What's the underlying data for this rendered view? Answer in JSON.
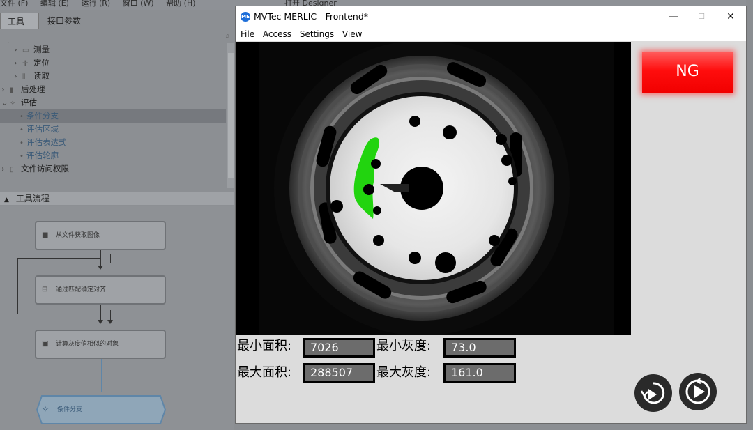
{
  "designer": {
    "menu": [
      "文件 (F)",
      "编辑 (E)",
      "运行 (R)",
      "窗口 (W)",
      "帮助 (H)",
      "打开 Designer"
    ],
    "tabs": [
      "工具库",
      "接口参数"
    ],
    "tree": [
      {
        "label": "测量",
        "level": 1
      },
      {
        "label": "定位",
        "level": 1
      },
      {
        "label": "读取",
        "level": 1
      },
      {
        "label": "后处理",
        "level": 0
      },
      {
        "label": "评估",
        "level": 0
      },
      {
        "label": "条件分支",
        "level": 2
      },
      {
        "label": "评估区域",
        "level": 2
      },
      {
        "label": "评估表达式",
        "level": 2
      },
      {
        "label": "评估轮廓",
        "level": 2
      },
      {
        "label": "文件访问权限",
        "level": 0
      }
    ],
    "section_title": "工具流程",
    "flow_steps": [
      "从文件获取图像",
      "通过匹配确定对齐",
      "计算灰度值相似的对象",
      "条件分支"
    ]
  },
  "merlic": {
    "title": "MVTec MERLIC - Frontend*",
    "logo_text": "ME",
    "menu": [
      {
        "label": "File",
        "accel": "F",
        "rest": "ile"
      },
      {
        "label": "Access",
        "accel": "A",
        "rest": "ccess"
      },
      {
        "label": "Settings",
        "accel": "S",
        "rest": "ettings"
      },
      {
        "label": "View",
        "accel": "V",
        "rest": "iew"
      }
    ],
    "window_controls": {
      "minimize": "—",
      "maximize": "☐",
      "close": "✕"
    },
    "result": "NG",
    "fields": {
      "min_area_label": "最小面积:",
      "min_area_value": "7026",
      "max_area_label": "最大面积:",
      "max_area_value": "288507",
      "min_gray_label": "最小灰度:",
      "min_gray_value": "73.0",
      "max_gray_label": "最大灰度:",
      "max_gray_value": "161.0"
    },
    "buttons": [
      "single-step-icon",
      "continuous-run-icon"
    ],
    "colors": {
      "ng_red": "#ff0d0d",
      "defect_green": "#22d40f",
      "title_blue": "#1e6fd9"
    }
  }
}
